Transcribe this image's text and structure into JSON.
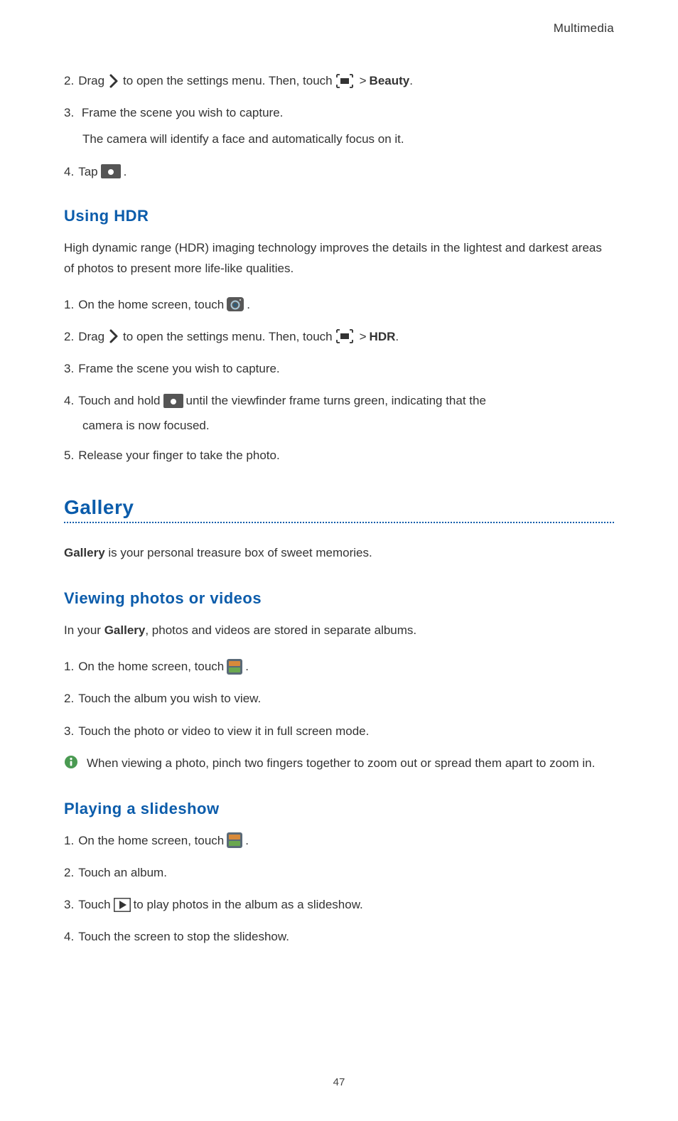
{
  "header": {
    "breadcrumb": "Multimedia"
  },
  "beauty_continued": {
    "step2_a": "Drag",
    "step2_b": "to open the settings menu. Then, touch",
    "step2_end_label": "Beauty",
    "step2_period": ".",
    "step3": "Frame the scene you wish to capture.",
    "step3_sub": "The camera will identify a face and automatically focus on it.",
    "step4_a": "Tap",
    "step4_period": "."
  },
  "hdr": {
    "heading": "Using HDR",
    "intro": "High dynamic range (HDR) imaging technology improves the details in the lightest and darkest areas of photos to present more life-like qualities.",
    "step1_a": "On the home screen, touch",
    "step1_period": ".",
    "step2_a": "Drag",
    "step2_b": "to open the settings menu. Then, touch",
    "step2_end_label": "HDR",
    "step2_period": ".",
    "step3": "Frame the scene you wish to capture.",
    "step4_a": "Touch and hold",
    "step4_b": "until the viewfinder frame turns green, indicating that the",
    "step4_cont": "camera is now focused.",
    "step5": "Release your finger to take the photo."
  },
  "gallery": {
    "heading": "Gallery",
    "intro_bold": "Gallery",
    "intro_rest": " is your personal treasure box of sweet memories."
  },
  "viewing": {
    "heading": "Viewing photos or videos",
    "intro_a": "In your ",
    "intro_bold": "Gallery",
    "intro_b": ", photos and videos are stored in separate albums.",
    "step1_a": "On the home screen, touch",
    "step1_period": ".",
    "step2": "Touch the album you wish to view.",
    "step3": "Touch the photo or video to view it in full screen mode.",
    "callout": "When viewing a photo, pinch two fingers together to zoom out or spread them apart to zoom in."
  },
  "slideshow": {
    "heading": "Playing a slideshow",
    "step1_a": "On the home screen, touch",
    "step1_period": ".",
    "step2": "Touch an album.",
    "step3_a": "Touch",
    "step3_b": "to play photos in the album as a slideshow.",
    "step4": "Touch the screen to stop the slideshow."
  },
  "labels": {
    "num2": "2.",
    "num3": "3.",
    "num4": "4.",
    "num1": "1.",
    "num5": "5.",
    "gt": ">"
  },
  "footer": {
    "page": "47"
  }
}
